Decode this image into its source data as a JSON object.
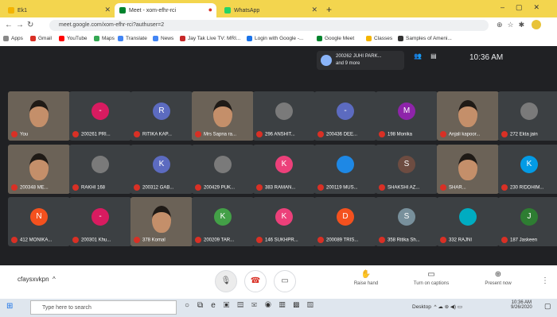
{
  "browser": {
    "tabs": [
      {
        "title": "Ek1",
        "color": "#f4b400"
      },
      {
        "title": "Meet - xom-efhr-rci",
        "color": "#00832d"
      },
      {
        "title": "WhatsApp",
        "color": "#25d366"
      }
    ],
    "new_tab": "+",
    "url": "meet.google.com/xom-efhr-rci?authuser=2",
    "bookmarks": [
      "Apps",
      "Gmail",
      "YouTube",
      "Maps",
      "Translate",
      "News",
      "Jay Tak Live TV: MRI...",
      "Login with Google -...",
      "Google Meet",
      "Classes",
      "Samples of Ameni..."
    ]
  },
  "meet": {
    "presenting_label": "200262 JUHI PARK...",
    "presenting_sub": "and 9 more",
    "time": "10:36 AM",
    "participants": [
      {
        "name": "You",
        "initial": "",
        "color": "",
        "video": true
      },
      {
        "name": "200261 PRI...",
        "initial": "-",
        "color": "#d81b60",
        "video": false
      },
      {
        "name": "RITIKA KAP...",
        "initial": "R",
        "color": "#5c6bc0",
        "video": false
      },
      {
        "name": "Mrs Sapna ra...",
        "initial": "",
        "color": "",
        "video": true
      },
      {
        "name": "296 ANSHIT...",
        "initial": "",
        "color": "",
        "video": false
      },
      {
        "name": "200436 DEE...",
        "initial": "-",
        "color": "#5c6bc0",
        "video": false
      },
      {
        "name": "198 Monika",
        "initial": "M",
        "color": "#8e24aa",
        "video": false
      },
      {
        "name": "Anjali kapoor...",
        "initial": "",
        "color": "",
        "video": true
      },
      {
        "name": "272 Ekta jain",
        "initial": "",
        "color": "",
        "video": false
      },
      {
        "name": "200348 ME...",
        "initial": "",
        "color": "",
        "video": true
      },
      {
        "name": "RAKHI 168",
        "initial": "",
        "color": "",
        "video": false
      },
      {
        "name": "200312 GAB...",
        "initial": "K",
        "color": "#5c6bc0",
        "video": false
      },
      {
        "name": "200429 PUK...",
        "initial": "",
        "color": "",
        "video": false
      },
      {
        "name": "383 RAMAN...",
        "initial": "K",
        "color": "#ec407a",
        "video": false
      },
      {
        "name": "200119 MUS...",
        "initial": "",
        "color": "#1e88e5",
        "video": false
      },
      {
        "name": "SHAKSHI AZ...",
        "initial": "S",
        "color": "#6d4c41",
        "video": false
      },
      {
        "name": "SHAR...",
        "initial": "",
        "color": "",
        "video": true
      },
      {
        "name": "230 RIDDHIM...",
        "initial": "K",
        "color": "#039be5",
        "video": false
      },
      {
        "name": "412 MONIKA...",
        "initial": "N",
        "color": "#f4511e",
        "video": false
      },
      {
        "name": "200301 Khu...",
        "initial": "-",
        "color": "#d81b60",
        "video": false
      },
      {
        "name": "378 Komal",
        "initial": "",
        "color": "",
        "video": true
      },
      {
        "name": "200209 TAR...",
        "initial": "K",
        "color": "#43a047",
        "video": false
      },
      {
        "name": "146 SUKHPR...",
        "initial": "K",
        "color": "#ec407a",
        "video": false
      },
      {
        "name": "200089 TRIS...",
        "initial": "D",
        "color": "#f4511e",
        "video": false
      },
      {
        "name": "358 Ritika Sh...",
        "initial": "S",
        "color": "#78909c",
        "video": false
      },
      {
        "name": "332 RAJNI",
        "initial": "",
        "color": "#00acc1",
        "video": false
      },
      {
        "name": "187 Jaskeen",
        "initial": "J",
        "color": "#2e7d32",
        "video": false
      }
    ],
    "meeting_code": "cfaysxvkpn",
    "actions": [
      {
        "label": "Raise hand",
        "icon": "✋"
      },
      {
        "label": "Turn on captions",
        "icon": "▭"
      },
      {
        "label": "Present now",
        "icon": "⊕"
      }
    ]
  },
  "taskbar": {
    "search_placeholder": "Type here to search",
    "desktop_label": "Desktop",
    "time": "10:36 AM",
    "date": "9/26/2020"
  }
}
